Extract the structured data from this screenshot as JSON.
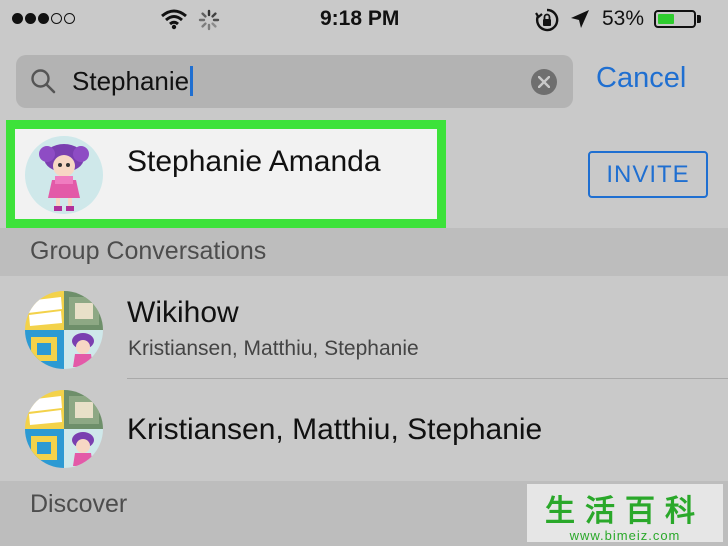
{
  "status_bar": {
    "time": "9:18 PM",
    "battery_percent": "53%",
    "battery_level": 0.53,
    "signal_bars_filled": 3,
    "signal_bars_total": 5
  },
  "search": {
    "value": "Stephanie",
    "cancel_label": "Cancel"
  },
  "contact": {
    "name": "Stephanie Amanda",
    "invite_label": "INVITE",
    "highlight_color": "#3de23a"
  },
  "group_conversations": {
    "header": "Group Conversations",
    "items": [
      {
        "title": "Wikihow",
        "subtitle": "Kristiansen, Matthiu, Stephanie"
      },
      {
        "title": "Kristiansen, Matthiu, Stephanie"
      }
    ]
  },
  "discover": {
    "header": "Discover"
  },
  "watermark": {
    "chars": "生活百科",
    "url": "www.bimeiz.com"
  },
  "colors": {
    "accent": "#1f6fd1",
    "background": "#c9c9c9"
  }
}
